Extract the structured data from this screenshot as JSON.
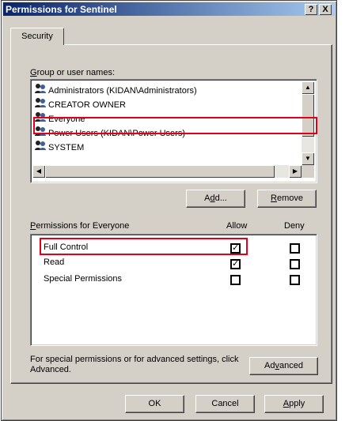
{
  "window": {
    "title": "Permissions for Sentinel",
    "help_button": "?",
    "close_button": "X"
  },
  "tabs": [
    {
      "label": "Security"
    }
  ],
  "group_label": "Group or user names:",
  "users": [
    {
      "name": "Administrators (KIDAN\\Administrators)",
      "icon": "users-group-icon"
    },
    {
      "name": "CREATOR OWNER",
      "icon": "users-group-icon"
    },
    {
      "name": "Everyone",
      "icon": "users-group-icon",
      "selected": true
    },
    {
      "name": "Power Users (KIDAN\\Power Users)",
      "icon": "users-group-icon"
    },
    {
      "name": "SYSTEM",
      "icon": "users-group-icon"
    }
  ],
  "buttons": {
    "add": "Add...",
    "remove": "Remove",
    "advanced": "Advanced",
    "ok": "OK",
    "cancel": "Cancel",
    "apply": "Apply"
  },
  "permissions": {
    "header_label": "Permissions for Everyone",
    "allow_label": "Allow",
    "deny_label": "Deny",
    "rows": [
      {
        "name": "Full Control",
        "allow": true,
        "deny": false
      },
      {
        "name": "Read",
        "allow": true,
        "deny": false
      },
      {
        "name": "Special Permissions",
        "allow": false,
        "deny": false
      }
    ]
  },
  "advanced_note": "For special permissions or for advanced settings, click Advanced.",
  "colors": {
    "highlight": "#e0001a",
    "title_bar": "#0a246a",
    "face": "#d4d0c8"
  }
}
